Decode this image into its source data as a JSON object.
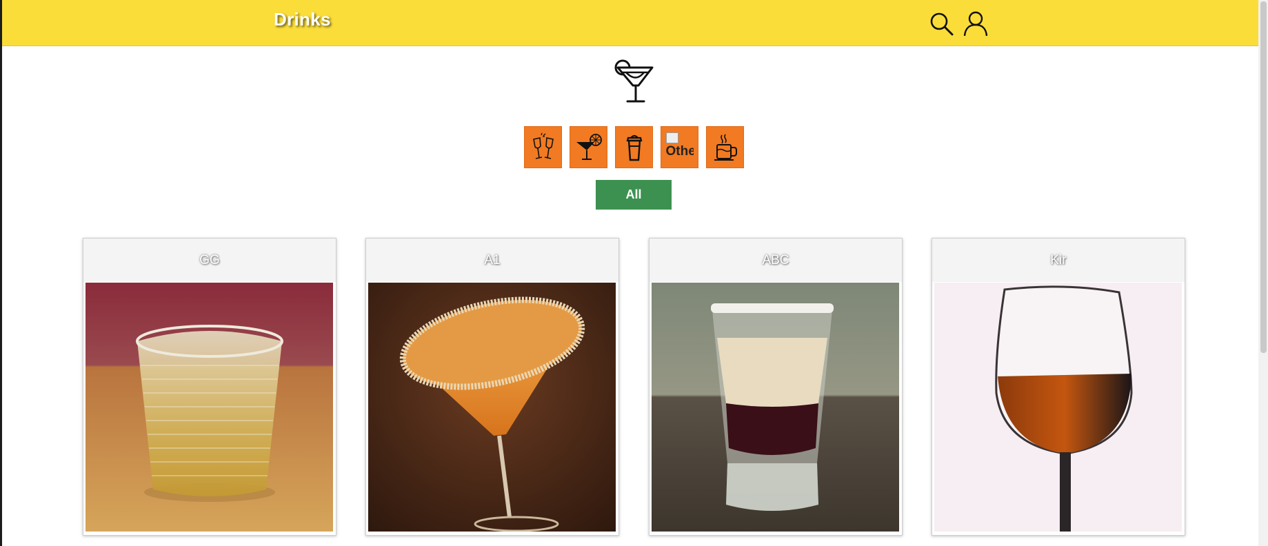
{
  "header": {
    "brand": "Drinks",
    "background_color": "#fbdd3a",
    "icons": [
      "search-icon",
      "user-icon"
    ]
  },
  "logo": {
    "icon": "margarita-glass-icon"
  },
  "categories": [
    {
      "icon": "champagne-toast-icon"
    },
    {
      "icon": "cocktail-lime-icon"
    },
    {
      "icon": "shaker-cup-icon"
    },
    {
      "icon": "broken-image-icon",
      "alt_text": "Othe"
    },
    {
      "icon": "hot-drink-mug-icon"
    }
  ],
  "category_color": "#f17a22",
  "filter": {
    "all_label": "All",
    "color": "#3d9150"
  },
  "drinks": [
    {
      "name": "GG",
      "image": "glass-tumbler-drink"
    },
    {
      "name": "A1",
      "image": "martini-glass-orange-drink"
    },
    {
      "name": "ABC",
      "image": "layered-shot-drink"
    },
    {
      "name": "Kir",
      "image": "wine-glass-drink"
    }
  ]
}
